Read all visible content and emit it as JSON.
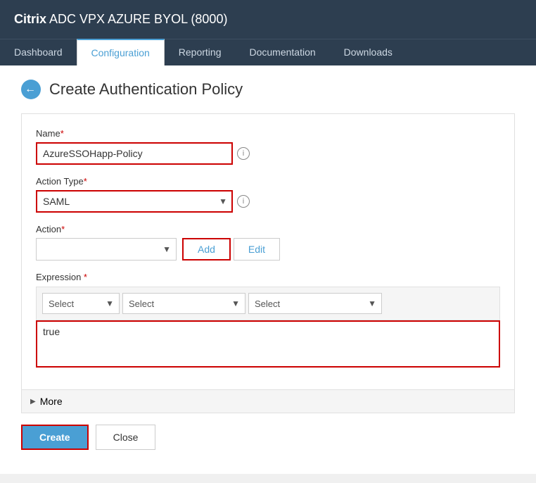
{
  "app": {
    "title_bold": "Citrix",
    "title_rest": " ADC VPX AZURE BYOL (8000)"
  },
  "nav": {
    "items": [
      {
        "id": "dashboard",
        "label": "Dashboard",
        "active": false
      },
      {
        "id": "configuration",
        "label": "Configuration",
        "active": true
      },
      {
        "id": "reporting",
        "label": "Reporting",
        "active": false
      },
      {
        "id": "documentation",
        "label": "Documentation",
        "active": false
      },
      {
        "id": "downloads",
        "label": "Downloads",
        "active": false
      }
    ]
  },
  "page": {
    "title": "Create Authentication Policy",
    "back_label": "←"
  },
  "form": {
    "name_label": "Name",
    "name_value": "AzureSSOHapp-Policy",
    "action_type_label": "Action Type",
    "action_type_value": "SAML",
    "action_label": "Action",
    "add_button": "Add",
    "edit_button": "Edit",
    "expression_label": "Expression",
    "expression_select1": "Select",
    "expression_select2": "Select",
    "expression_select3": "Select",
    "expression_value": "true",
    "more_label": "More",
    "create_button": "Create",
    "close_button": "Close"
  }
}
